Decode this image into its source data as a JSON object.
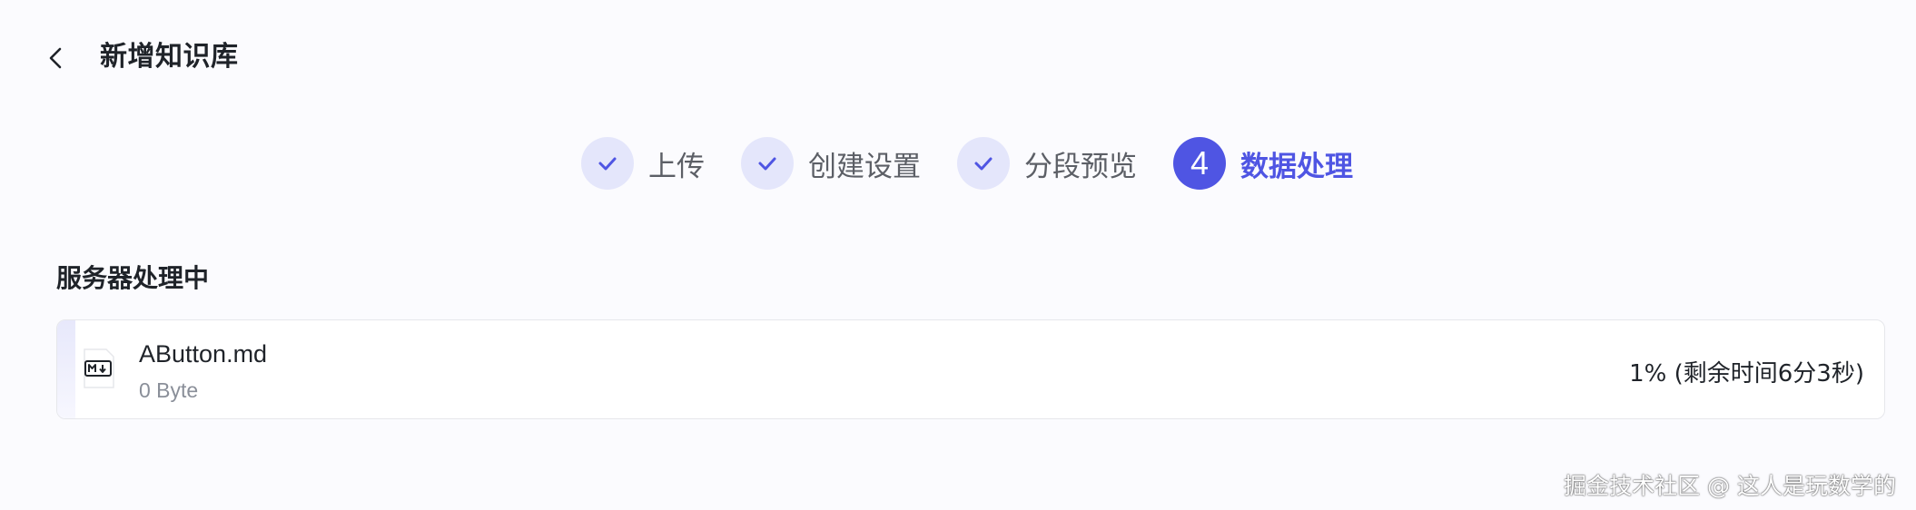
{
  "header": {
    "title": "新增知识库",
    "back_icon": "chevron-left-icon"
  },
  "steps": [
    {
      "label": "上传",
      "state": "done",
      "icon": "check-icon"
    },
    {
      "label": "创建设置",
      "state": "done",
      "icon": "check-icon"
    },
    {
      "label": "分段预览",
      "state": "done",
      "icon": "check-icon"
    },
    {
      "label": "数据处理",
      "state": "active",
      "number": "4"
    }
  ],
  "section": {
    "title": "服务器处理中"
  },
  "file": {
    "name": "AButton.md",
    "size": "0 Byte",
    "progress_text": "1% (剩余时间6分3秒)",
    "progress_fraction": 0.01,
    "icon": "markdown-file-icon"
  },
  "watermark": "掘金技术社区 @ 这人是玩数学的",
  "colors": {
    "accent": "#4f55e3",
    "step_done_bg": "#e4e6fb",
    "page_bg": "#fbfbfe"
  }
}
